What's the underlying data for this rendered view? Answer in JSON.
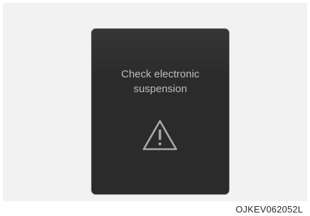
{
  "display": {
    "message_line1": "Check electronic",
    "message_line2": "suspension",
    "icon": "warning-triangle-icon",
    "background_color": "#2b2b2b",
    "text_color": "#bdbdbd"
  },
  "caption": {
    "code": "OJKEV062052L"
  }
}
